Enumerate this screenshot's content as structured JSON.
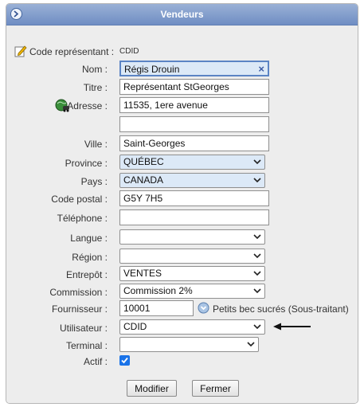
{
  "window": {
    "title": "Vendeurs"
  },
  "header": {
    "code_label": "Code représentant :",
    "code_value": "CDID"
  },
  "fields": {
    "nom": {
      "label": "Nom :",
      "value": "Régis Drouin"
    },
    "titre": {
      "label": "Titre :",
      "value": "Représentant StGeorges"
    },
    "adresse": {
      "label": "Adresse :",
      "value": "11535, 1ere avenue",
      "value2": ""
    },
    "ville": {
      "label": "Ville :",
      "value": "Saint-Georges"
    },
    "province": {
      "label": "Province :",
      "value": "QUÉBEC"
    },
    "pays": {
      "label": "Pays :",
      "value": "CANADA"
    },
    "code_postal": {
      "label": "Code postal :",
      "value": "G5Y 7H5"
    },
    "telephone": {
      "label": "Téléphone :",
      "value": ""
    },
    "langue": {
      "label": "Langue :",
      "value": ""
    },
    "region": {
      "label": "Région :",
      "value": ""
    },
    "entrepot": {
      "label": "Entrepôt :",
      "value": "VENTES"
    },
    "commission": {
      "label": "Commission :",
      "value": "Commission 2%"
    },
    "fournisseur": {
      "label": "Fournisseur :",
      "value": "10001",
      "name": "Petits bec sucrés (Sous-traitant)"
    },
    "utilisateur": {
      "label": "Utilisateur :",
      "value": "CDID"
    },
    "terminal": {
      "label": "Terminal :",
      "value": ""
    },
    "actif": {
      "label": "Actif :",
      "checked": true
    }
  },
  "buttons": {
    "modifier": "Modifier",
    "fermer": "Fermer"
  },
  "colors": {
    "titlebar": "#7b97c9",
    "highlight": "#dce9f7",
    "body": "#ededed"
  }
}
